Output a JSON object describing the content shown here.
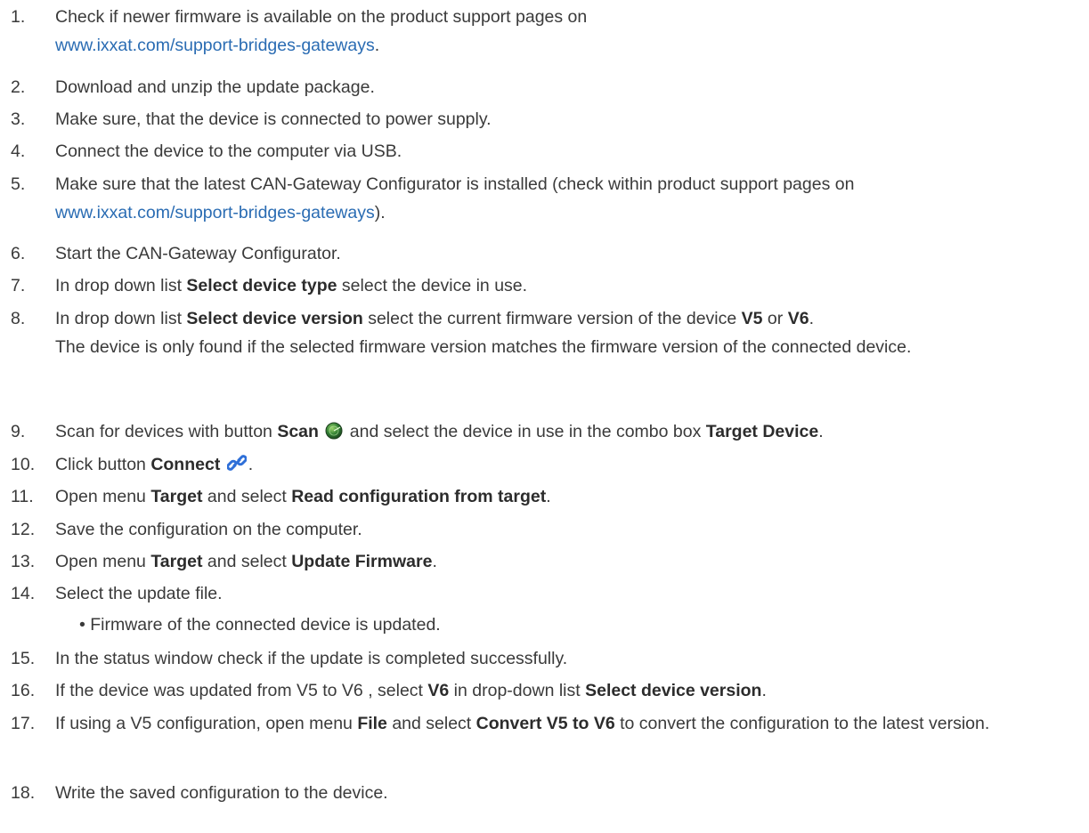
{
  "steps": [
    {
      "num": "1.",
      "a": "Check if newer firmware is available on the product support pages on",
      "link": "www.ixxat.com/support-bridges-gateways",
      "b": "."
    },
    {
      "num": "2.",
      "text": "Download and unzip the update package."
    },
    {
      "num": "3.",
      "text": "Make sure, that the device is connected to power supply."
    },
    {
      "num": "4.",
      "text": "Connect the device to the computer via USB."
    },
    {
      "num": "5.",
      "a": "Make sure that the latest CAN-Gateway Configurator is installed (check within product support pages on",
      "link": "www.ixxat.com/support-bridges-gateways",
      "b": ")."
    },
    {
      "num": "6.",
      "text": "Start the CAN-Gateway Configurator."
    },
    {
      "num": "7.",
      "a": "In drop down list ",
      "bold": "Select device type",
      "b": " select the device in use."
    },
    {
      "num": "8.",
      "a": "In drop down list ",
      "bold1": "Select device version",
      "b": " select the current firmware version of the device ",
      "bold2": "V5",
      "c": " or ",
      "bold3": "V6",
      "d": ".",
      "note": "The device is only found if the selected firmware version matches the firmware version of the connected device."
    },
    {
      "num": "9.",
      "a": "Scan for devices with button ",
      "bold1": "Scan",
      "b": " and select the device in use in the combo box ",
      "bold2": "Target Device",
      "c": "."
    },
    {
      "num": "10.",
      "a": "Click button ",
      "bold": "Connect",
      "b": "."
    },
    {
      "num": "11.",
      "a": "Open menu ",
      "bold1": "Target",
      "b": " and select ",
      "bold2": "Read configuration from target",
      "c": "."
    },
    {
      "num": "12.",
      "text": "Save the configuration on the computer."
    },
    {
      "num": "13.",
      "a": "Open menu ",
      "bold1": "Target",
      "b": " and select ",
      "bold2": "Update Firmware",
      "c": "."
    },
    {
      "num": "14.",
      "text": "Select the update file.",
      "bullet": "•  Firmware of the connected device is updated."
    },
    {
      "num": "15.",
      "text": "In the status window check if the update is completed successfully."
    },
    {
      "num": "16.",
      "a": "If the device was updated from V5 to V6 , select ",
      "bold1": "V6",
      "b": " in drop-down list ",
      "bold2": "Select device version",
      "c": "."
    },
    {
      "num": "17.",
      "a": "If using a V5 configuration, open menu ",
      "bold1": "File",
      "b": " and select ",
      "bold2": "Convert V5 to V6",
      "c": " to convert the configuration to the latest version."
    },
    {
      "num": "18.",
      "text": "Write the saved configuration to the device."
    }
  ],
  "icons": {
    "scan": "radar-scan-icon",
    "connect": "chain-link-icon"
  },
  "colors": {
    "link": "#2a6cb3",
    "text": "#3a3a3a",
    "scan_icon": "#2f7d33",
    "connect_icon": "#2e6fd8"
  }
}
